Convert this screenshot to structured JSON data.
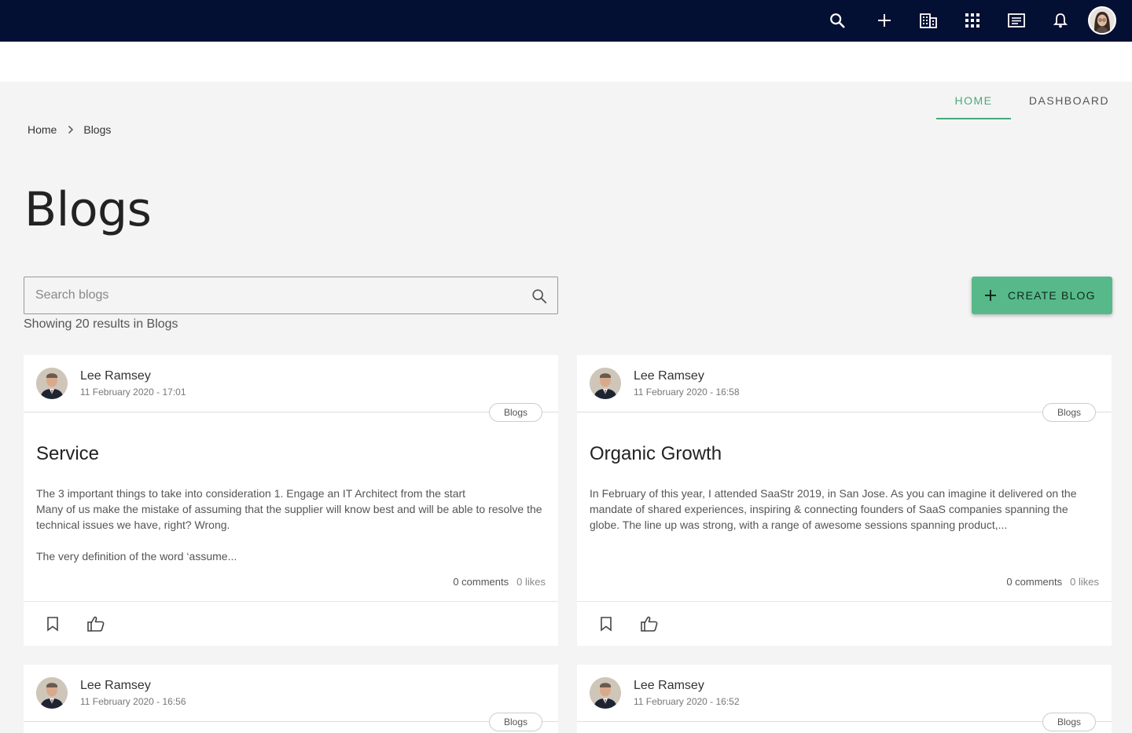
{
  "nav": {
    "icons": [
      "search-icon",
      "plus-icon",
      "building-icon",
      "apps-grid-icon",
      "news-icon",
      "bell-icon"
    ],
    "tabs": [
      {
        "label": "HOME",
        "active": true
      },
      {
        "label": "DASHBOARD",
        "active": false
      }
    ],
    "accent": "#4aa97a",
    "topbar_color": "#030f33"
  },
  "breadcrumb": {
    "items": [
      "Home",
      "Blogs"
    ]
  },
  "page": {
    "title": "Blogs"
  },
  "search": {
    "placeholder": "Search blogs",
    "value": ""
  },
  "results": {
    "text": "Showing 20 results in Blogs"
  },
  "actions": {
    "create_label": "CREATE BLOG",
    "button_color": "#57b98a"
  },
  "posts": [
    {
      "author": "Lee Ramsey",
      "date": "11 February 2020 - 17:01",
      "tag": "Blogs",
      "title": "Service",
      "body": "The 3 important things to take into consideration 1. Engage an IT Architect from the start\nMany of us make the mistake of assuming that the supplier will know best and will be able to resolve the technical issues we have, right? Wrong.\n\nThe very definition of the word ‘assume...",
      "comments": "0 comments",
      "likes": "0 likes"
    },
    {
      "author": "Lee Ramsey",
      "date": "11 February 2020 - 16:58",
      "tag": "Blogs",
      "title": "Organic Growth",
      "body": "In February of this year, I attended SaaStr 2019, in San Jose. As you can imagine it delivered on the mandate of shared experiences, inspiring & connecting founders of SaaS companies spanning the globe. The line up was strong, with a range of awesome sessions spanning product,...",
      "comments": "0 comments",
      "likes": "0 likes"
    },
    {
      "author": "Lee Ramsey",
      "date": "11 February 2020 - 16:56",
      "tag": "Blogs"
    },
    {
      "author": "Lee Ramsey",
      "date": "11 February 2020 - 16:52",
      "tag": "Blogs"
    }
  ]
}
